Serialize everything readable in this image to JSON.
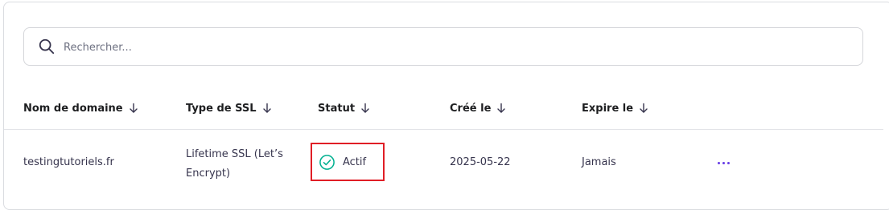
{
  "search": {
    "placeholder": "Rechercher..."
  },
  "table": {
    "columns": [
      {
        "label": "Nom de domaine"
      },
      {
        "label": "Type de SSL"
      },
      {
        "label": "Statut"
      },
      {
        "label": "Créé le"
      },
      {
        "label": "Expire le"
      }
    ],
    "rows": [
      {
        "domain": "testingtutoriels.fr",
        "ssl_type": "Lifetime SSL (Let’s Encrypt)",
        "status": "Actif",
        "created": "2025-05-22",
        "expires": "Jamais"
      }
    ]
  },
  "colors": {
    "status_active": "#00b090",
    "highlight_border": "#e01e26",
    "actions_dots": "#673de6"
  },
  "icons": {
    "search": "search-icon",
    "sort": "arrow-down-icon",
    "status": "check-circle-icon",
    "actions": "more-horizontal-icon"
  }
}
